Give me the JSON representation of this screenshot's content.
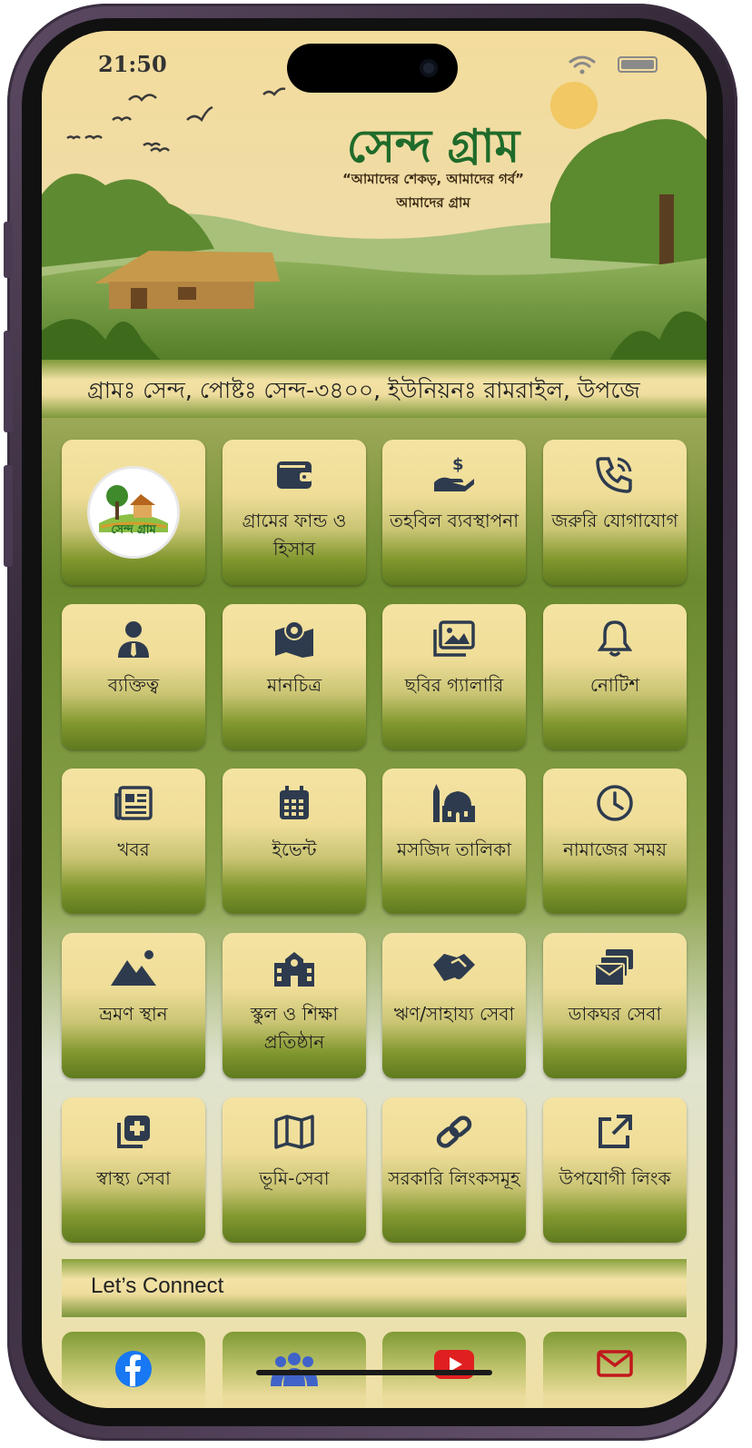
{
  "status_bar": {
    "time": "21:50"
  },
  "banner": {
    "title": "সেন্দ গ্রাম",
    "tagline": "“আমাদের শেকড়, আমাদের গর্ব”",
    "subtitle": "আমাদের গ্রাম"
  },
  "address": "গ্রামঃ সেন্দ, পোষ্টঃ সেন্দ-৩৪০০, ইউনিয়নঃ রামরাইল, উপজে",
  "logo": {
    "text": "সেন্দ গ্রাম"
  },
  "menu": [
    {
      "label": "গ্রামের ফান্ড ও হিসাব",
      "icon": "wallet-icon"
    },
    {
      "label": "তহবিল ব্যবস্থাপনা",
      "icon": "hand-dollar-icon"
    },
    {
      "label": "জরুরি যোগাযোগ",
      "icon": "phone-icon"
    },
    {
      "label": "ব্যক্তিত্ব",
      "icon": "person-icon"
    },
    {
      "label": "মানচিত্র",
      "icon": "map-pin-icon"
    },
    {
      "label": "ছবির গ্যালারি",
      "icon": "gallery-icon"
    },
    {
      "label": "নোটিশ",
      "icon": "bell-icon"
    },
    {
      "label": "খবর",
      "icon": "newspaper-icon"
    },
    {
      "label": "ইভেন্ট",
      "icon": "calendar-icon"
    },
    {
      "label": "মসজিদ তালিকা",
      "icon": "mosque-icon"
    },
    {
      "label": "নামাজের সময়",
      "icon": "clock-icon"
    },
    {
      "label": "ভ্রমণ স্থান",
      "icon": "mountain-icon"
    },
    {
      "label": "স্কুল ও শিক্ষা প্রতিষ্ঠান",
      "icon": "school-icon"
    },
    {
      "label": "ঋণ/সাহায্য সেবা",
      "icon": "handshake-icon"
    },
    {
      "label": "ডাকঘর সেবা",
      "icon": "mail-stack-icon"
    },
    {
      "label": "স্বাস্থ্য সেবা",
      "icon": "medical-plus-icon"
    },
    {
      "label": "ভূমি-সেবা",
      "icon": "folded-map-icon"
    },
    {
      "label": "সরকারি লিংকসমূহ",
      "icon": "link-icon"
    },
    {
      "label": "উপযোগী লিংক",
      "icon": "external-link-icon"
    }
  ],
  "connect": {
    "label": "Let’s Connect"
  },
  "social": [
    "facebook-icon",
    "group-icon",
    "youtube-icon",
    "email-icon"
  ],
  "colors": {
    "icon": "#2e3b4e",
    "title_green": "#1f6b2a",
    "facebook": "#1877f2",
    "youtube": "#e02020",
    "email": "#c2181d",
    "group": "#3f63c8"
  }
}
